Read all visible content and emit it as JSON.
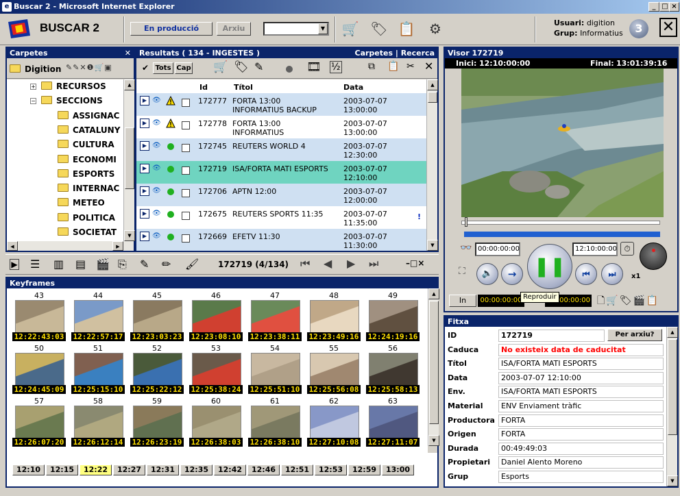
{
  "window": {
    "title": "Buscar 2 - Microsoft Internet Explorer"
  },
  "toolbar": {
    "app_name": "BUSCAR 2",
    "btn_production": "En producció",
    "btn_archive": "Arxiu",
    "user_label": "Usuari:",
    "user_value": "digition",
    "group_label": "Grup:",
    "group_value": "Informatius",
    "badge": "3"
  },
  "folders": {
    "title": "Carpetes",
    "root": "Digition",
    "items": [
      {
        "label": "RECURSOS",
        "level": 1
      },
      {
        "label": "SECCIONS",
        "level": 1
      },
      {
        "label": "ASSIGNAC",
        "level": 2
      },
      {
        "label": "CATALUNY",
        "level": 2
      },
      {
        "label": "CULTURA",
        "level": 2
      },
      {
        "label": "ECONOMI",
        "level": 2
      },
      {
        "label": "ESPORTS",
        "level": 2
      },
      {
        "label": "INTERNAC",
        "level": 2
      },
      {
        "label": "METEO",
        "level": 2
      },
      {
        "label": "POLITICA",
        "level": 2
      },
      {
        "label": "SOCIETAT",
        "level": 2
      }
    ]
  },
  "results": {
    "title": "Resultats ( 134 - INGESTES )",
    "links": "Carpetes | Recerca",
    "btn_all": "Tots",
    "btn_none": "Cap",
    "col_id": "Id",
    "col_title": "Títol",
    "col_date": "Data",
    "rows": [
      {
        "id": "172777",
        "title1": "FORTA 13:00",
        "title2": "INFORMATIUS BACKUP",
        "date1": "2003-07-07",
        "date2": "13:00:00",
        "status": "warning"
      },
      {
        "id": "172778",
        "title1": "FORTA 13:00",
        "title2": "INFORMATIUS",
        "date1": "2003-07-07",
        "date2": "13:00:00",
        "status": "warning"
      },
      {
        "id": "172745",
        "title1": "REUTERS WORLD 4",
        "title2": "",
        "date1": "2003-07-07",
        "date2": "12:30:00",
        "status": "ok"
      },
      {
        "id": "172719",
        "title1": "ISA/FORTA MATI ESPORTS",
        "title2": "",
        "date1": "2003-07-07",
        "date2": "12:10:00",
        "status": "ok"
      },
      {
        "id": "172706",
        "title1": "APTN 12:00",
        "title2": "",
        "date1": "2003-07-07",
        "date2": "12:00:00",
        "status": "ok"
      },
      {
        "id": "172675",
        "title1": "REUTERS SPORTS 11:35",
        "title2": "",
        "date1": "2003-07-07",
        "date2": "11:35:00",
        "status": "ok"
      },
      {
        "id": "172669",
        "title1": "EFETV 11:30",
        "title2": "",
        "date1": "2003-07-07",
        "date2": "11:30:00",
        "status": "ok"
      }
    ],
    "mark": "!"
  },
  "nav": {
    "position": "172719 (4/134)"
  },
  "keyframes": {
    "title": "Keyframes",
    "items": [
      {
        "n": "43",
        "tc": "12:22:43:03"
      },
      {
        "n": "44",
        "tc": "12:22:57:17"
      },
      {
        "n": "45",
        "tc": "12:23:03:23"
      },
      {
        "n": "46",
        "tc": "12:23:08:10"
      },
      {
        "n": "47",
        "tc": "12:23:38:11"
      },
      {
        "n": "48",
        "tc": "12:23:49:16"
      },
      {
        "n": "49",
        "tc": "12:24:19:16"
      },
      {
        "n": "50",
        "tc": "12:24:45:09"
      },
      {
        "n": "51",
        "tc": "12:25:15:10"
      },
      {
        "n": "52",
        "tc": "12:25:22:12"
      },
      {
        "n": "53",
        "tc": "12:25:38:24"
      },
      {
        "n": "54",
        "tc": "12:25:51:10"
      },
      {
        "n": "55",
        "tc": "12:25:56:08"
      },
      {
        "n": "56",
        "tc": "12:25:58:13"
      },
      {
        "n": "57",
        "tc": "12:26:07:20"
      },
      {
        "n": "58",
        "tc": "12:26:12:14"
      },
      {
        "n": "59",
        "tc": "12:26:23:19"
      },
      {
        "n": "60",
        "tc": "12:26:38:03"
      },
      {
        "n": "61",
        "tc": "12:26:38:10"
      },
      {
        "n": "62",
        "tc": "12:27:10:08"
      },
      {
        "n": "63",
        "tc": "12:27:11:07"
      }
    ],
    "timebar": [
      "12:10",
      "12:15",
      "12:22",
      "12:27",
      "12:31",
      "12:35",
      "12:42",
      "12:46",
      "12:51",
      "12:53",
      "12:59",
      "13:00"
    ],
    "timebar_active": "12:22"
  },
  "viewer": {
    "title": "Visor  172719",
    "start_label": "Inici:",
    "start_value": "12:10:00:00",
    "end_label": "Final:",
    "end_value": "13:01:39:16",
    "tc_current": "00:00:00:00",
    "tc_target": "12:10:00:00",
    "speed": "x1",
    "in_label": "In",
    "in_value": "00:00:00:00",
    "out_value": "00:00:00:00",
    "tooltip": "Reproduir"
  },
  "record": {
    "title": "Fitxa",
    "archive_button": "Per arxiu?",
    "fields": [
      {
        "label": "ID",
        "value": "172719"
      },
      {
        "label": "Caduca",
        "value": "No existeix data de caducitat"
      },
      {
        "label": "Títol",
        "value": "ISA/FORTA MATI ESPORTS"
      },
      {
        "label": "Data",
        "value": "2003-07-07 12:10:00"
      },
      {
        "label": "Env.",
        "value": "ISA/FORTA MATI ESPORTS"
      },
      {
        "label": "Material",
        "value": "ENV Enviament tràfic"
      },
      {
        "label": "Productora",
        "value": "FORTA"
      },
      {
        "label": "Origen",
        "value": "FORTA"
      },
      {
        "label": "Durada",
        "value": "00:49:49:03"
      },
      {
        "label": "Propietari",
        "value": "Daniel Alento Moreno"
      },
      {
        "label": "Grup",
        "value": "Esports"
      }
    ]
  },
  "colors": {
    "title_bg": "#0a246a",
    "row_alt": "#cfe0f2",
    "row_selected": "#6fd4c0",
    "warning_red": "#ff0000",
    "timecode_yellow": "#ffe000"
  }
}
